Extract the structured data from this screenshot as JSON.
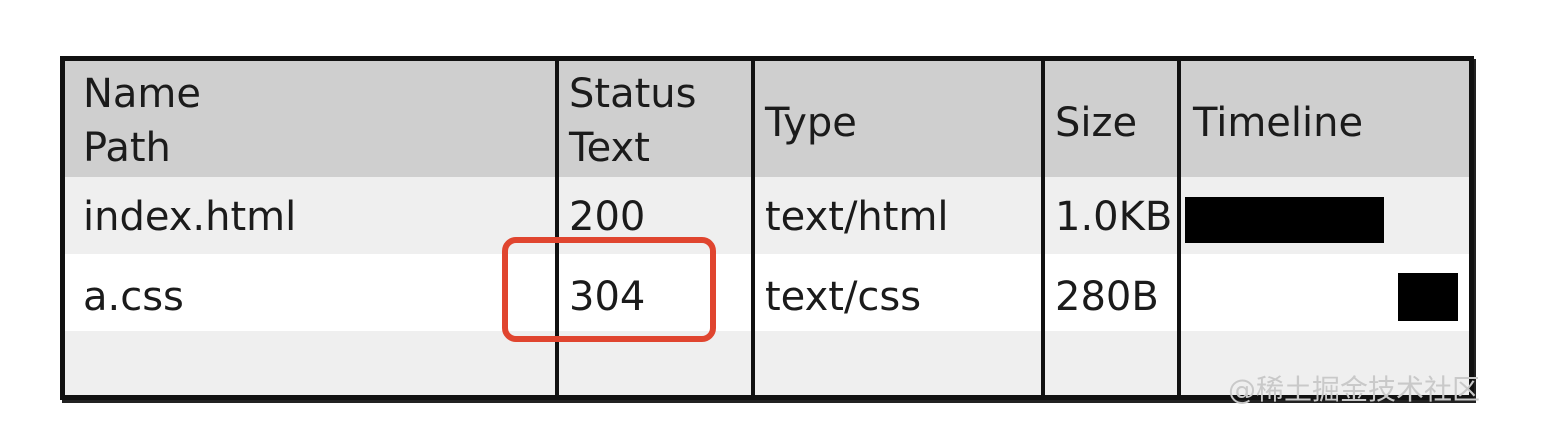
{
  "table": {
    "headers": {
      "name_path": [
        "Name",
        "Path"
      ],
      "status_text": [
        "Status",
        "Text"
      ],
      "type": "Type",
      "size": "Size",
      "timeline": "Timeline"
    },
    "rows": [
      {
        "name": "index.html",
        "status": "200",
        "type": "text/html",
        "size": "1.0KB",
        "timeline_fraction_start": 0.0,
        "timeline_fraction_end": 0.7
      },
      {
        "name": "a.css",
        "status": "304",
        "type": "text/css",
        "size": "280B",
        "timeline_fraction_start": 0.75,
        "timeline_fraction_end": 0.96
      }
    ]
  },
  "colors": {
    "highlight": "#e0452f",
    "header_bg": "#cfcfcf",
    "row_alt_bg": "#efefef"
  },
  "watermark": "@稀土掘金技术社区"
}
